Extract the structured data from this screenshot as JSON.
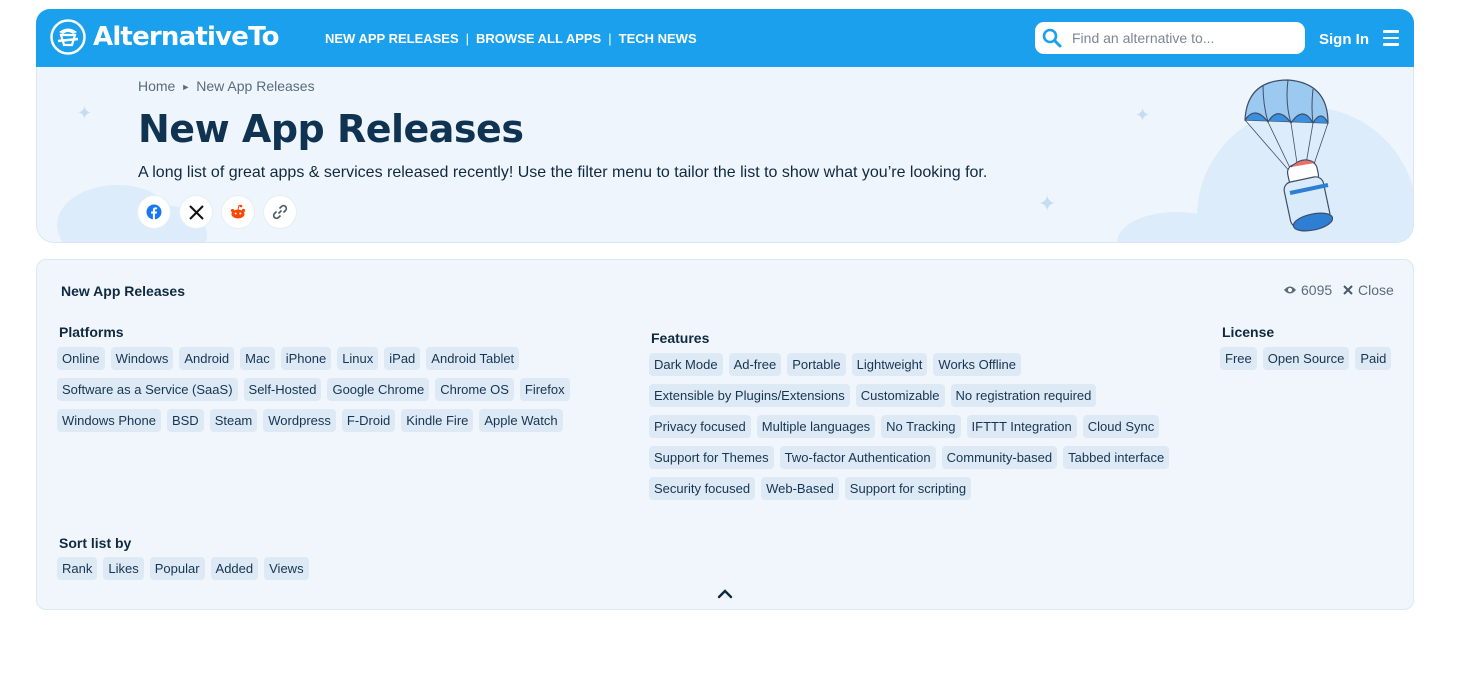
{
  "header": {
    "logo_text": "AlternativeTo",
    "nav": [
      "NEW APP RELEASES",
      "BROWSE ALL APPS",
      "TECH NEWS"
    ],
    "nav_sep": "|",
    "search_placeholder": "Find an alternative to...",
    "signin": "Sign In",
    "brand_color": "#1ba0ee"
  },
  "hero": {
    "breadcrumb": [
      "Home",
      "New App Releases"
    ],
    "title": "New App Releases",
    "description": "A long list of great apps & services released recently! Use the filter menu to tailor the list to show what you’re looking for.",
    "share_icons": [
      "facebook-icon",
      "x-icon",
      "reddit-icon",
      "link-icon"
    ]
  },
  "filters": {
    "title": "New App Releases",
    "views": "6095",
    "close": "Close",
    "platforms_label": "Platforms",
    "platforms": [
      "Online",
      "Windows",
      "Android",
      "Mac",
      "iPhone",
      "Linux",
      "iPad",
      "Android Tablet",
      "Software as a Service (SaaS)",
      "Self-Hosted",
      "Google Chrome",
      "Chrome OS",
      "Firefox",
      "Windows Phone",
      "BSD",
      "Steam",
      "Wordpress",
      "F-Droid",
      "Kindle Fire",
      "Apple Watch"
    ],
    "features_label": "Features",
    "features": [
      "Dark Mode",
      "Ad-free",
      "Portable",
      "Lightweight",
      "Works Offline",
      "Extensible by Plugins/Extensions",
      "Customizable",
      "No registration required",
      "Privacy focused",
      "Multiple languages",
      "No Tracking",
      "IFTTT Integration",
      "Cloud Sync",
      "Support for Themes",
      "Two-factor Authentication",
      "Community-based",
      "Tabbed interface",
      "Security focused",
      "Web-Based",
      "Support for scripting"
    ],
    "license_label": "License",
    "license": [
      "Free",
      "Open Source",
      "Paid"
    ],
    "sort_label": "Sort list by",
    "sort": [
      "Rank",
      "Likes",
      "Popular",
      "Added",
      "Views"
    ]
  }
}
